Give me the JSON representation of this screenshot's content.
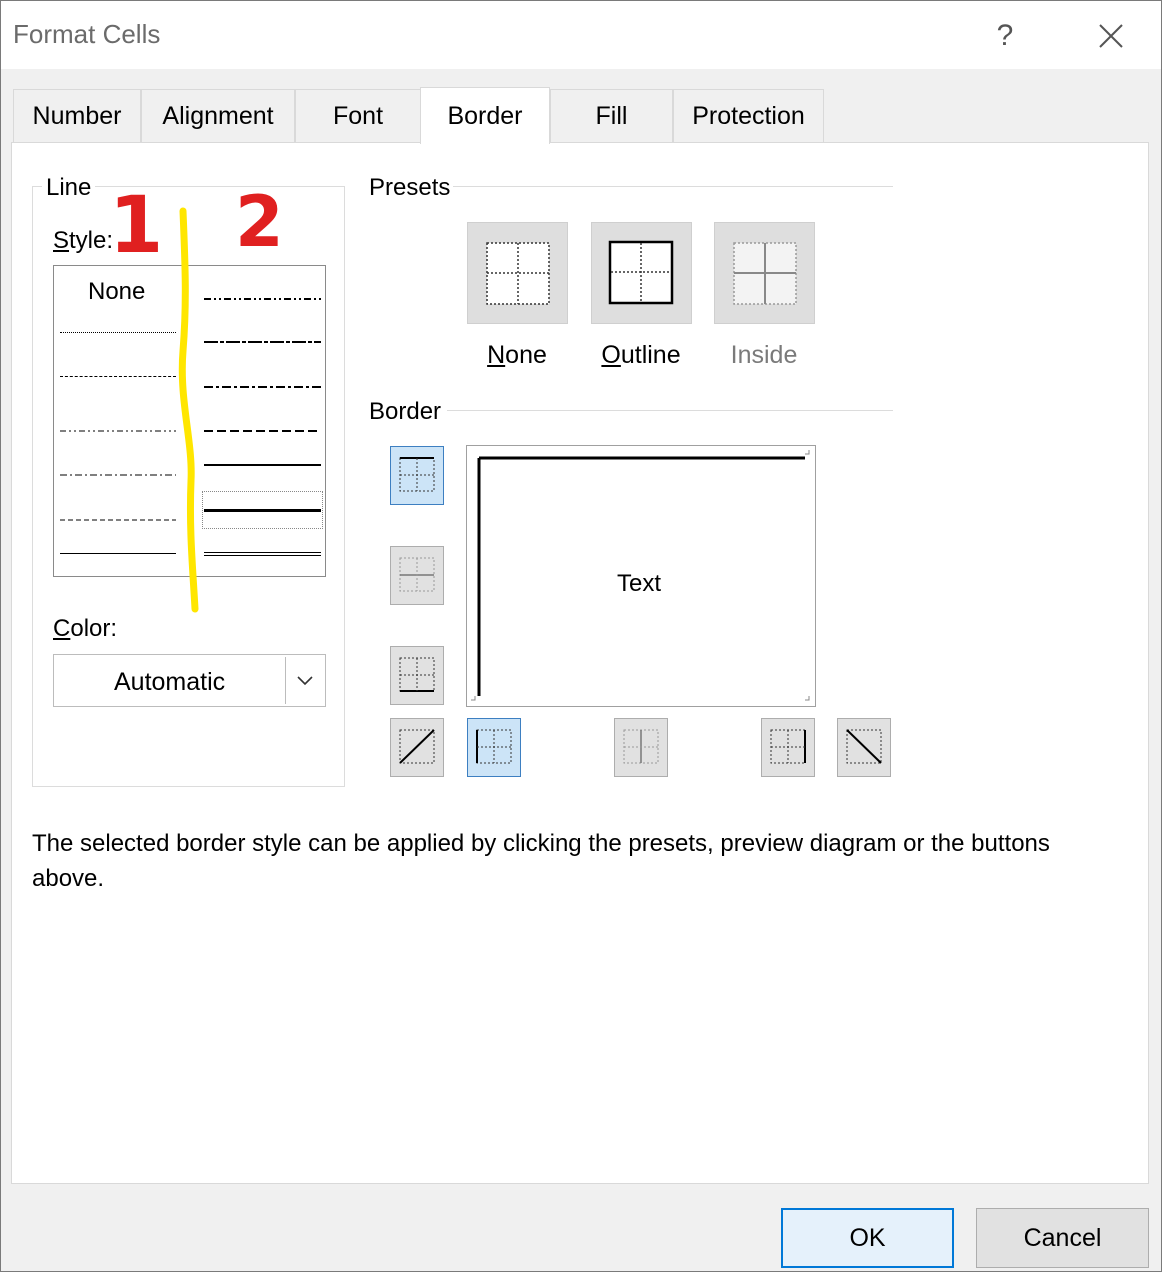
{
  "window": {
    "title": "Format Cells",
    "help_glyph": "?",
    "close_glyph": "✕"
  },
  "tabs": [
    {
      "label": "Number"
    },
    {
      "label": "Alignment"
    },
    {
      "label": "Font"
    },
    {
      "label": "Border",
      "active": true
    },
    {
      "label": "Fill"
    },
    {
      "label": "Protection"
    }
  ],
  "line": {
    "group_label": "Line",
    "style_label_first": "S",
    "style_label_rest": "tyle:",
    "none_label": "None",
    "color_label_first": "C",
    "color_label_rest": "olor:",
    "color_value": "Automatic"
  },
  "presets": {
    "group_label": "Presets",
    "items": [
      {
        "label_first": "N",
        "label_rest": "one",
        "icon": "preset-none-icon"
      },
      {
        "label_first": "O",
        "label_rest": "utline",
        "icon": "preset-outline-icon"
      },
      {
        "label_first": "",
        "label_rest": "Inside",
        "icon": "preset-inside-icon",
        "disabled": true
      }
    ]
  },
  "border": {
    "group_label": "Border",
    "preview_text": "Text",
    "buttons": [
      {
        "name": "border-top-button",
        "icon": "border-top-icon",
        "pressed": true
      },
      {
        "name": "border-inside-horizontal-button",
        "icon": "border-inside-horizontal-icon",
        "disabled": true
      },
      {
        "name": "border-bottom-button",
        "icon": "border-bottom-icon",
        "pressed": false
      },
      {
        "name": "border-diagonal-up-button",
        "icon": "diagonal-up-icon",
        "pressed": false
      },
      {
        "name": "border-left-button",
        "icon": "border-left-icon",
        "pressed": true
      },
      {
        "name": "border-inside-vertical-button",
        "icon": "border-inside-vertical-icon",
        "disabled": true
      },
      {
        "name": "border-right-button",
        "icon": "border-right-icon",
        "pressed": false
      },
      {
        "name": "border-diagonal-down-button",
        "icon": "diagonal-down-icon",
        "pressed": false
      }
    ]
  },
  "description": "The selected border style can be applied by clicking the presets, preview diagram or the buttons above.",
  "footer": {
    "ok_label": "OK",
    "cancel_label": "Cancel"
  },
  "annotations": {
    "mark_1": "1",
    "mark_2": "2",
    "mark_color": "#e02020",
    "highlight_color": "#ffe600"
  },
  "colors": {
    "selected_button_bg": "#cce4f7",
    "selected_button_border": "#3d7fc1",
    "ok_border": "#0078d7"
  }
}
